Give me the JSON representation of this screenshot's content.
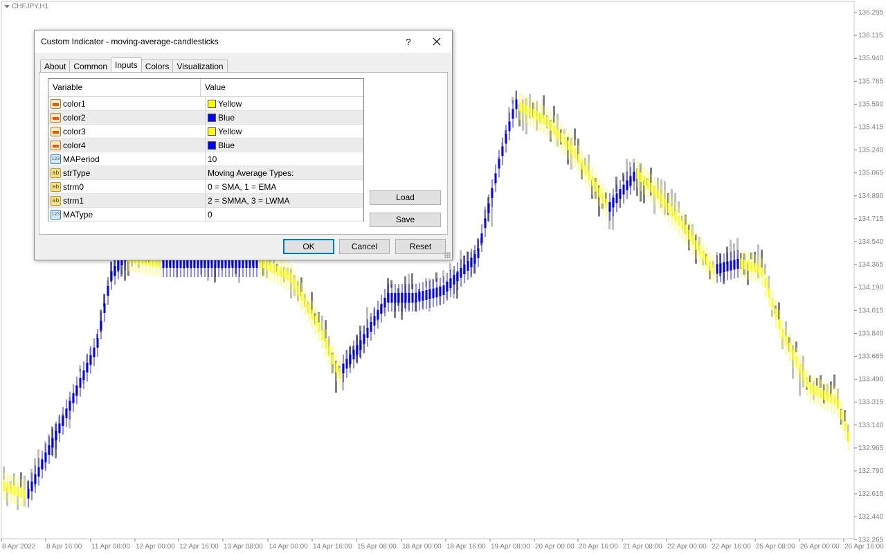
{
  "chart": {
    "symbol": "CHFJPY,H1",
    "price_axis": [
      "136.295",
      "136.115",
      "135.940",
      "135.765",
      "135.590",
      "135.415",
      "135.240",
      "135.065",
      "134.890",
      "134.715",
      "134.540",
      "134.365",
      "134.190",
      "134.015",
      "133.840",
      "133.665",
      "133.490",
      "133.315",
      "133.140",
      "132.965",
      "132.790",
      "132.615",
      "132.440",
      "132.265"
    ],
    "time_axis": [
      "8 Apr 2022",
      "8 Apr 16:00",
      "11 Apr 08:00",
      "12 Apr 00:00",
      "12 Apr 16:00",
      "13 Apr 08:00",
      "14 Apr 00:00",
      "14 Apr 16:00",
      "15 Apr 08:00",
      "18 Apr 00:00",
      "18 Apr 16:00",
      "19 Apr 08:00",
      "20 Apr 00:00",
      "20 Apr 16:00",
      "21 Apr 08:00",
      "22 Apr 00:00",
      "22 Apr 16:00",
      "25 Apr 08:00",
      "26 Apr 00:00",
      "26 Apr 16:00"
    ],
    "colors": {
      "up": "#0000ff",
      "down": "#ffff00",
      "shadow": "#808080",
      "wick": "#c0c0c0"
    }
  },
  "dialog": {
    "title": "Custom Indicator - moving-average-candlesticks",
    "help_label": "?",
    "tabs": [
      "About",
      "Common",
      "Inputs",
      "Colors",
      "Visualization"
    ],
    "active_tab": "Inputs",
    "columns": {
      "variable": "Variable",
      "value": "Value"
    },
    "params": [
      {
        "icon": "color-param-icon",
        "name": "color1",
        "value": "Yellow",
        "swatch": "#ffff00"
      },
      {
        "icon": "color-param-icon",
        "name": "color2",
        "value": "Blue",
        "swatch": "#0000ff"
      },
      {
        "icon": "color-param-icon",
        "name": "color3",
        "value": "Yellow",
        "swatch": "#ffff00"
      },
      {
        "icon": "color-param-icon",
        "name": "color4",
        "value": "Blue",
        "swatch": "#0000ff"
      },
      {
        "icon": "number-param-icon",
        "icon_text": "123",
        "name": "MAPeriod",
        "value": "10"
      },
      {
        "icon": "string-param-icon",
        "icon_text": "ab",
        "name": "strType",
        "value": "Moving Average Types:"
      },
      {
        "icon": "string-param-icon",
        "icon_text": "ab",
        "name": "strm0",
        "value": "0 = SMA,  1 = EMA"
      },
      {
        "icon": "string-param-icon",
        "icon_text": "ab",
        "name": "strm1",
        "value": "2 = SMMA, 3 = LWMA"
      },
      {
        "icon": "number-param-icon",
        "icon_text": "123",
        "name": "MAType",
        "value": "0"
      }
    ],
    "buttons": {
      "load": "Load",
      "save": "Save",
      "ok": "OK",
      "cancel": "Cancel",
      "reset": "Reset"
    }
  }
}
